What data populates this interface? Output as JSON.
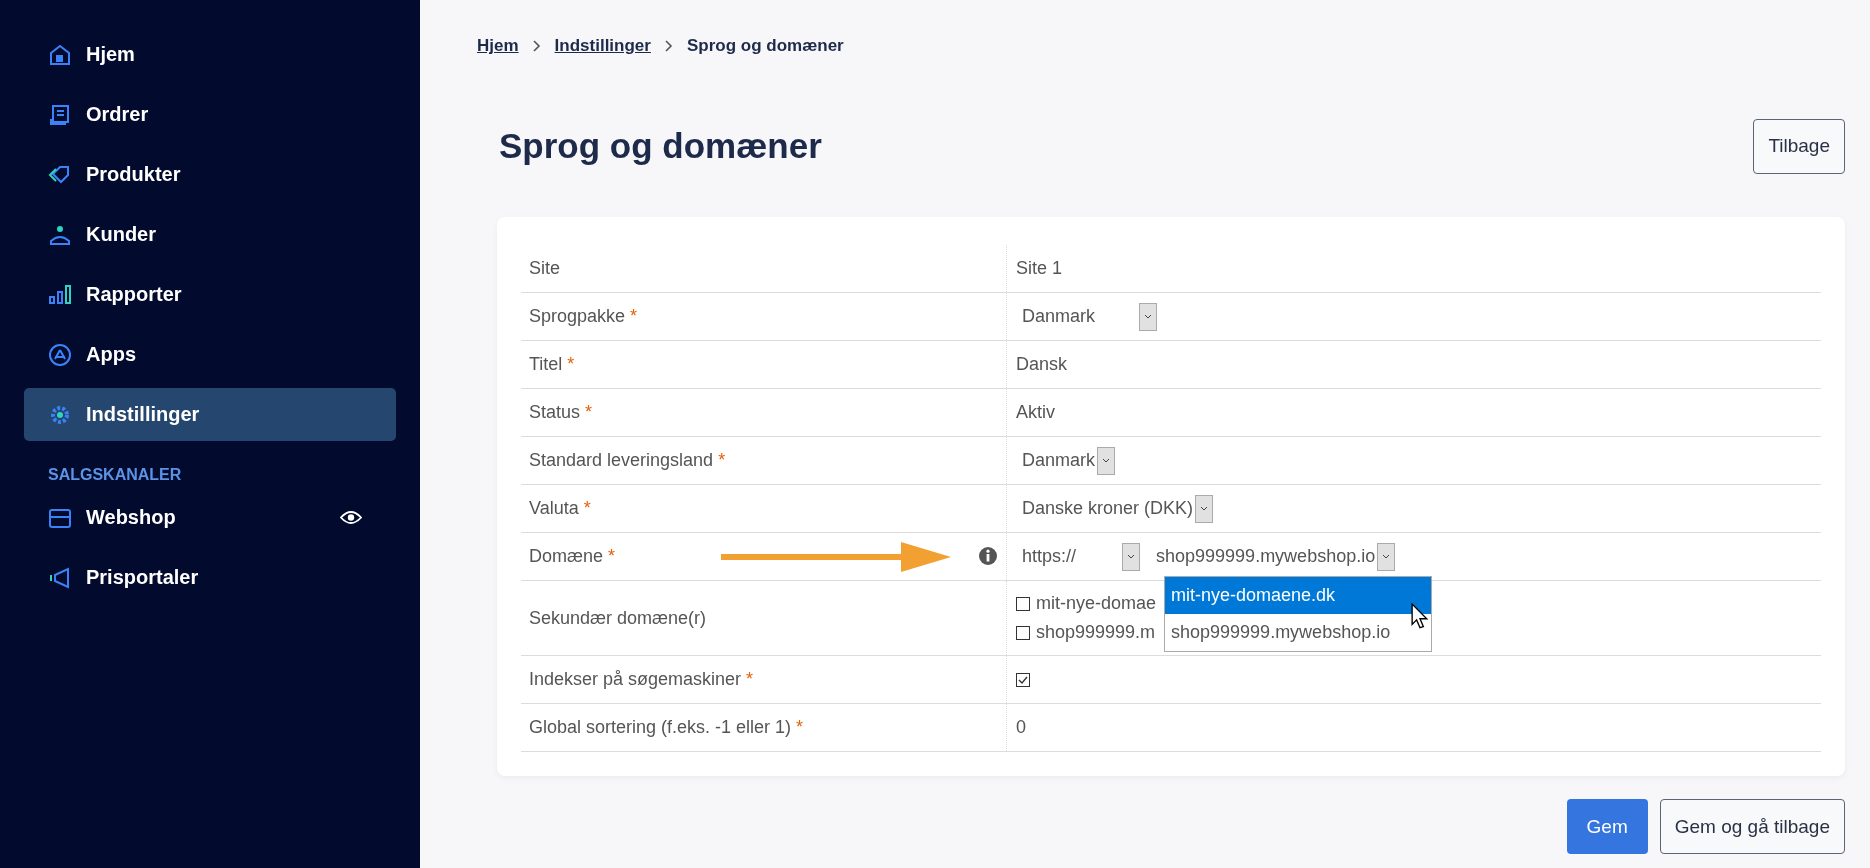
{
  "sidebar": {
    "items": [
      {
        "label": "Hjem",
        "selected": false
      },
      {
        "label": "Ordrer",
        "selected": false
      },
      {
        "label": "Produkter",
        "selected": false
      },
      {
        "label": "Kunder",
        "selected": false
      },
      {
        "label": "Rapporter",
        "selected": false
      },
      {
        "label": "Apps",
        "selected": false
      },
      {
        "label": "Indstillinger",
        "selected": true
      }
    ],
    "section_title": "SALGSKANALER",
    "section_items": [
      {
        "label": "Webshop",
        "selected": false
      },
      {
        "label": "Prisportaler",
        "selected": false
      }
    ]
  },
  "breadcrumb": [
    "Hjem",
    "Indstillinger",
    "Sprog og domæner"
  ],
  "title": "Sprog og domæner",
  "back_button": "Tilbage",
  "form": {
    "rows": [
      {
        "label": "Site",
        "kind": "text",
        "value": "Site 1"
      },
      {
        "label": "Sprogpakke",
        "marker": "*",
        "kind": "select",
        "value": "Danmark"
      },
      {
        "label": "Titel",
        "marker": "*",
        "kind": "text",
        "value": "Dansk"
      },
      {
        "label": "Status",
        "marker": "*",
        "kind": "text",
        "value": "Aktiv"
      },
      {
        "label": "Standard leveringsland",
        "marker": "*",
        "kind": "select",
        "value": "Danmark"
      },
      {
        "label": "Valuta",
        "marker": "*",
        "kind": "select",
        "value": "Danske kroner (DKK)"
      },
      {
        "label": "Domæne",
        "marker": "*",
        "kind": "domain",
        "protocol": "https://",
        "value": "shop999999.mywebshop.io",
        "options": [
          {
            "label": "mit-nye-domaene.dk",
            "highlighted": true
          },
          {
            "label": "shop999999.mywebshop.io",
            "highlighted": false
          }
        ]
      },
      {
        "label": "Sekundær domæne(r)",
        "kind": "checklist",
        "items": [
          {
            "label": "mit-nye-domae",
            "checked": false
          },
          {
            "label": "shop999999.m",
            "checked": false
          }
        ]
      },
      {
        "label": "Indekser på søgemaskiner",
        "marker": "*",
        "kind": "checkbox",
        "checked": true
      },
      {
        "label": "Global sortering (f.eks. -1 eller 1)",
        "marker": "*",
        "kind": "text",
        "value": "0"
      }
    ]
  },
  "actions": [
    "Gem",
    "Gem og gå tilbage"
  ]
}
